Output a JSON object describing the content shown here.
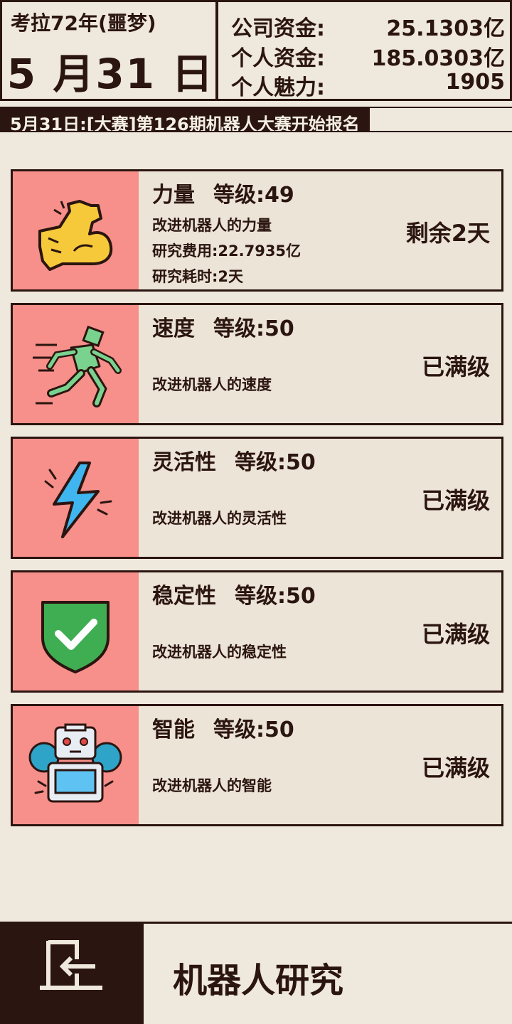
{
  "header": {
    "year_label": "考拉72年(噩梦)",
    "date": "5 月31 日",
    "stats": [
      {
        "label": "公司资金:",
        "value": "25.1303亿"
      },
      {
        "label": "个人资金:",
        "value": "185.0303亿"
      },
      {
        "label": "个人魅力:",
        "value": "1905"
      }
    ]
  },
  "ticker": {
    "text": "5月31日:[大赛]第126期机器人大赛开始报名"
  },
  "research_items": [
    {
      "name": "力量",
      "level": "等级:49",
      "description": "改进机器人的力量",
      "cost": "研究费用:22.7935亿",
      "time": "研究耗时:2天",
      "status": "剩余2天",
      "icon": "flexed-arm-icon"
    },
    {
      "name": "速度",
      "level": "等级:50",
      "description": "改进机器人的速度",
      "status": "已满级",
      "icon": "running-robot-icon"
    },
    {
      "name": "灵活性",
      "level": "等级:50",
      "description": "改进机器人的灵活性",
      "status": "已满级",
      "icon": "lightning-icon"
    },
    {
      "name": "稳定性",
      "level": "等级:50",
      "description": "改进机器人的稳定性",
      "status": "已满级",
      "icon": "shield-check-icon"
    },
    {
      "name": "智能",
      "level": "等级:50",
      "description": "改进机器人的智能",
      "status": "已满级",
      "icon": "robot-gear-icon"
    }
  ],
  "footer": {
    "title": "机器人研究",
    "back_icon": "exit-door-icon"
  },
  "colors": {
    "dark": "#2b1510",
    "background": "#efe8dc",
    "icon_panel": "#f78f8a"
  }
}
